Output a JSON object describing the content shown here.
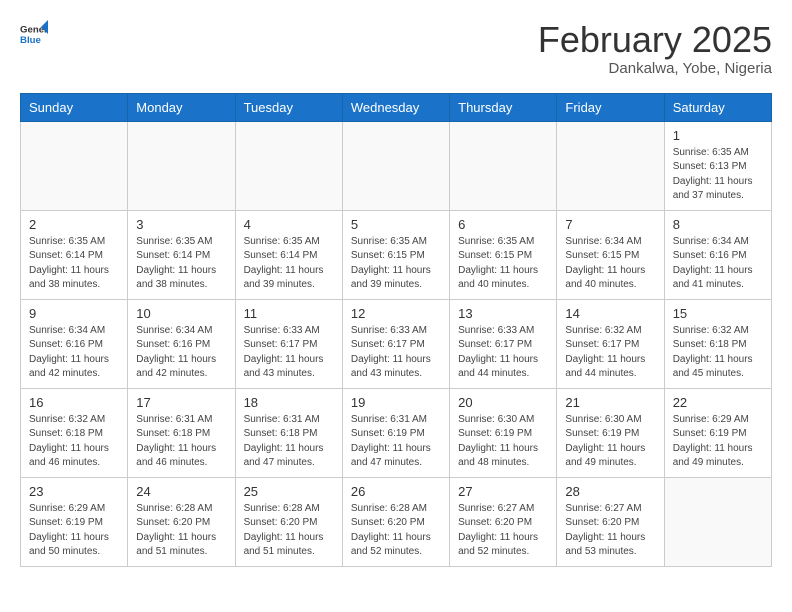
{
  "logo": {
    "line1": "General",
    "line2": "Blue"
  },
  "title": "February 2025",
  "location": "Dankalwa, Yobe, Nigeria",
  "weekdays": [
    "Sunday",
    "Monday",
    "Tuesday",
    "Wednesday",
    "Thursday",
    "Friday",
    "Saturday"
  ],
  "weeks": [
    [
      {
        "day": "",
        "info": ""
      },
      {
        "day": "",
        "info": ""
      },
      {
        "day": "",
        "info": ""
      },
      {
        "day": "",
        "info": ""
      },
      {
        "day": "",
        "info": ""
      },
      {
        "day": "",
        "info": ""
      },
      {
        "day": "1",
        "info": "Sunrise: 6:35 AM\nSunset: 6:13 PM\nDaylight: 11 hours and 37 minutes."
      }
    ],
    [
      {
        "day": "2",
        "info": "Sunrise: 6:35 AM\nSunset: 6:14 PM\nDaylight: 11 hours and 38 minutes."
      },
      {
        "day": "3",
        "info": "Sunrise: 6:35 AM\nSunset: 6:14 PM\nDaylight: 11 hours and 38 minutes."
      },
      {
        "day": "4",
        "info": "Sunrise: 6:35 AM\nSunset: 6:14 PM\nDaylight: 11 hours and 39 minutes."
      },
      {
        "day": "5",
        "info": "Sunrise: 6:35 AM\nSunset: 6:15 PM\nDaylight: 11 hours and 39 minutes."
      },
      {
        "day": "6",
        "info": "Sunrise: 6:35 AM\nSunset: 6:15 PM\nDaylight: 11 hours and 40 minutes."
      },
      {
        "day": "7",
        "info": "Sunrise: 6:34 AM\nSunset: 6:15 PM\nDaylight: 11 hours and 40 minutes."
      },
      {
        "day": "8",
        "info": "Sunrise: 6:34 AM\nSunset: 6:16 PM\nDaylight: 11 hours and 41 minutes."
      }
    ],
    [
      {
        "day": "9",
        "info": "Sunrise: 6:34 AM\nSunset: 6:16 PM\nDaylight: 11 hours and 42 minutes."
      },
      {
        "day": "10",
        "info": "Sunrise: 6:34 AM\nSunset: 6:16 PM\nDaylight: 11 hours and 42 minutes."
      },
      {
        "day": "11",
        "info": "Sunrise: 6:33 AM\nSunset: 6:17 PM\nDaylight: 11 hours and 43 minutes."
      },
      {
        "day": "12",
        "info": "Sunrise: 6:33 AM\nSunset: 6:17 PM\nDaylight: 11 hours and 43 minutes."
      },
      {
        "day": "13",
        "info": "Sunrise: 6:33 AM\nSunset: 6:17 PM\nDaylight: 11 hours and 44 minutes."
      },
      {
        "day": "14",
        "info": "Sunrise: 6:32 AM\nSunset: 6:17 PM\nDaylight: 11 hours and 44 minutes."
      },
      {
        "day": "15",
        "info": "Sunrise: 6:32 AM\nSunset: 6:18 PM\nDaylight: 11 hours and 45 minutes."
      }
    ],
    [
      {
        "day": "16",
        "info": "Sunrise: 6:32 AM\nSunset: 6:18 PM\nDaylight: 11 hours and 46 minutes."
      },
      {
        "day": "17",
        "info": "Sunrise: 6:31 AM\nSunset: 6:18 PM\nDaylight: 11 hours and 46 minutes."
      },
      {
        "day": "18",
        "info": "Sunrise: 6:31 AM\nSunset: 6:18 PM\nDaylight: 11 hours and 47 minutes."
      },
      {
        "day": "19",
        "info": "Sunrise: 6:31 AM\nSunset: 6:19 PM\nDaylight: 11 hours and 47 minutes."
      },
      {
        "day": "20",
        "info": "Sunrise: 6:30 AM\nSunset: 6:19 PM\nDaylight: 11 hours and 48 minutes."
      },
      {
        "day": "21",
        "info": "Sunrise: 6:30 AM\nSunset: 6:19 PM\nDaylight: 11 hours and 49 minutes."
      },
      {
        "day": "22",
        "info": "Sunrise: 6:29 AM\nSunset: 6:19 PM\nDaylight: 11 hours and 49 minutes."
      }
    ],
    [
      {
        "day": "23",
        "info": "Sunrise: 6:29 AM\nSunset: 6:19 PM\nDaylight: 11 hours and 50 minutes."
      },
      {
        "day": "24",
        "info": "Sunrise: 6:28 AM\nSunset: 6:20 PM\nDaylight: 11 hours and 51 minutes."
      },
      {
        "day": "25",
        "info": "Sunrise: 6:28 AM\nSunset: 6:20 PM\nDaylight: 11 hours and 51 minutes."
      },
      {
        "day": "26",
        "info": "Sunrise: 6:28 AM\nSunset: 6:20 PM\nDaylight: 11 hours and 52 minutes."
      },
      {
        "day": "27",
        "info": "Sunrise: 6:27 AM\nSunset: 6:20 PM\nDaylight: 11 hours and 52 minutes."
      },
      {
        "day": "28",
        "info": "Sunrise: 6:27 AM\nSunset: 6:20 PM\nDaylight: 11 hours and 53 minutes."
      },
      {
        "day": "",
        "info": ""
      }
    ]
  ]
}
